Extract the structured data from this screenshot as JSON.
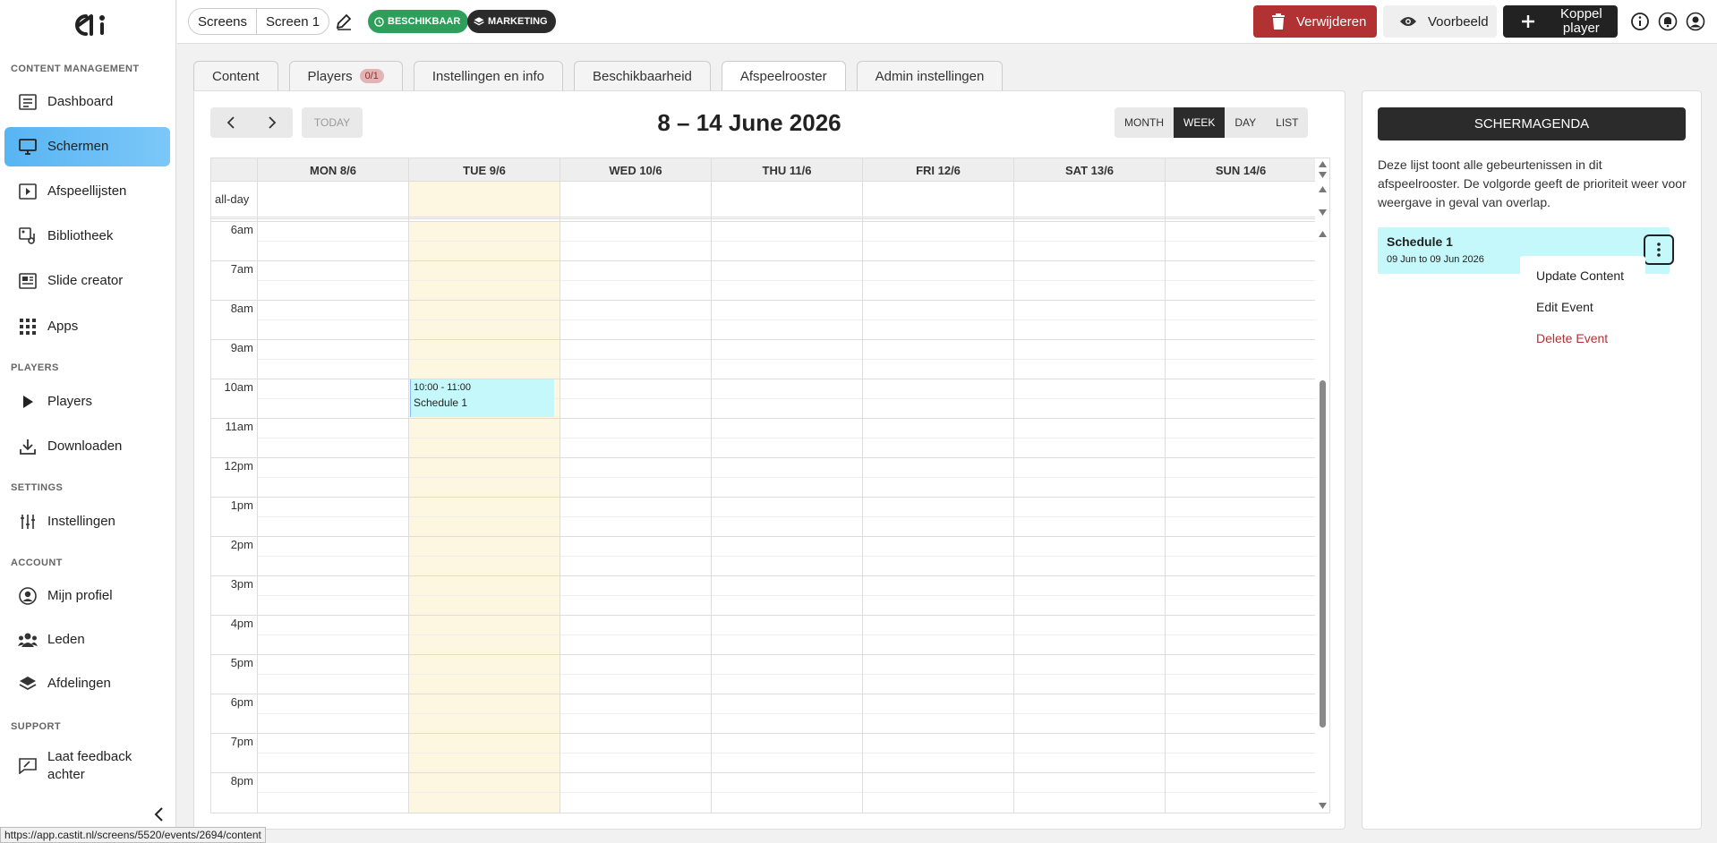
{
  "sidebar": {
    "sections": {
      "content": "CONTENT MANAGEMENT",
      "players": "PLAYERS",
      "settings": "SETTINGS",
      "account": "ACCOUNT",
      "support": "SUPPORT"
    },
    "items": {
      "dashboard": "Dashboard",
      "schermen": "Schermen",
      "afspeellijsten": "Afspeellijsten",
      "bibliotheek": "Bibliotheek",
      "slide_creator": "Slide creator",
      "apps": "Apps",
      "players": "Players",
      "downloaden": "Downloaden",
      "instellingen": "Instellingen",
      "mijn_profiel": "Mijn profiel",
      "leden": "Leden",
      "afdelingen": "Afdelingen",
      "feedback_line1": "Laat feedback",
      "feedback_line2": "achter"
    },
    "active_color": "#5eb9f5"
  },
  "topbar": {
    "breadcrumb": [
      "Screens",
      "Screen 1"
    ],
    "badges": {
      "status": "BESCHIKBAAR",
      "department": "MARKETING"
    },
    "buttons": {
      "delete": "Verwijderen",
      "preview": "Voorbeeld",
      "link_line1": "Koppel",
      "link_line2": "player"
    }
  },
  "tabs": {
    "content": "Content",
    "players": "Players",
    "players_count": "0/1",
    "settings": "Instellingen en info",
    "availability": "Beschikbaarheid",
    "schedule": "Afspeelrooster",
    "admin": "Admin instellingen"
  },
  "calendar": {
    "title": "8 – 14 June 2026",
    "today": "TODAY",
    "views": {
      "month": "MONTH",
      "week": "WEEK",
      "day": "DAY",
      "list": "LIST"
    },
    "active_view": "WEEK",
    "days": [
      "MON 8/6",
      "TUE 9/6",
      "WED 10/6",
      "THU 11/6",
      "FRI 12/6",
      "SAT 13/6",
      "SUN 14/6"
    ],
    "today_column": "TUE 9/6",
    "allday_label": "all-day",
    "times": [
      "6am",
      "7am",
      "8am",
      "9am",
      "10am",
      "11am",
      "12pm",
      "1pm",
      "2pm",
      "3pm",
      "4pm",
      "5pm",
      "6pm",
      "7pm",
      "8pm"
    ],
    "event": {
      "time": "10:00 - 11:00",
      "title": "Schedule 1",
      "day": "TUE 9/6",
      "color": "#c4f8fa"
    }
  },
  "panel": {
    "title": "SCHERMAGENDA",
    "description": "Deze lijst toont alle gebeurtenissen in dit afspeelrooster. De volgorde geeft de prioriteit weer voor weergave in geval van overlap.",
    "schedule": {
      "title": "Schedule 1",
      "dates": "09 Jun to 09 Jun 2026"
    },
    "menu": {
      "update": "Update Content",
      "edit": "Edit Event",
      "delete": "Delete Event"
    }
  },
  "status_url": "https://app.castit.nl/screens/5520/events/2694/content",
  "colors": {
    "danger": "#b23234",
    "success": "#2e9e5b",
    "dark": "#222222",
    "today_bg": "#fdf6e0"
  }
}
